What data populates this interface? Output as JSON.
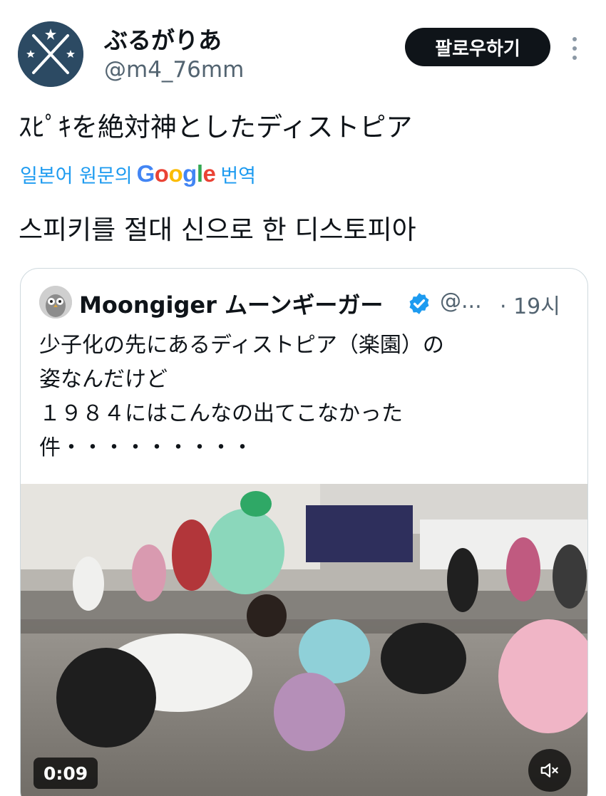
{
  "author": {
    "display_name": "ぶるがりあ",
    "handle": "@m4_76mm",
    "avatar_icon": "crossed-rifles-avatar"
  },
  "actions": {
    "follow_label": "팔로우하기",
    "more_icon": "vertical-dots-icon"
  },
  "post": {
    "text": "ｽﾋﾟｷを絶対神としたディストピア",
    "translate": {
      "prefix": "일본어 원문의",
      "brand": [
        "G",
        "o",
        "o",
        "g",
        "l",
        "e"
      ],
      "action": "번역"
    },
    "translated_text": "스피키를 절대 신으로 한 디스토피아"
  },
  "quote": {
    "display_name": "Moongiger ムーンギーガー",
    "verified_icon": "verified-badge-icon",
    "handle": "@...",
    "time": "· 19시",
    "text_lines": [
      "少子化の先にあるディストピア（楽園）の",
      "姿なんだけど",
      "１９８４にはこんなの出てこなかった",
      "件・・・・・・・・・"
    ],
    "video": {
      "duration": "0:09",
      "mute_icon": "speaker-muted-icon"
    }
  },
  "colors": {
    "link": "#1d9bf0",
    "muted": "#536471",
    "text": "#0f1419",
    "follow_bg": "#0f1419",
    "google": [
      "#4285F4",
      "#EA4335",
      "#FBBC05",
      "#4285F4",
      "#34A853",
      "#EA4335"
    ]
  }
}
